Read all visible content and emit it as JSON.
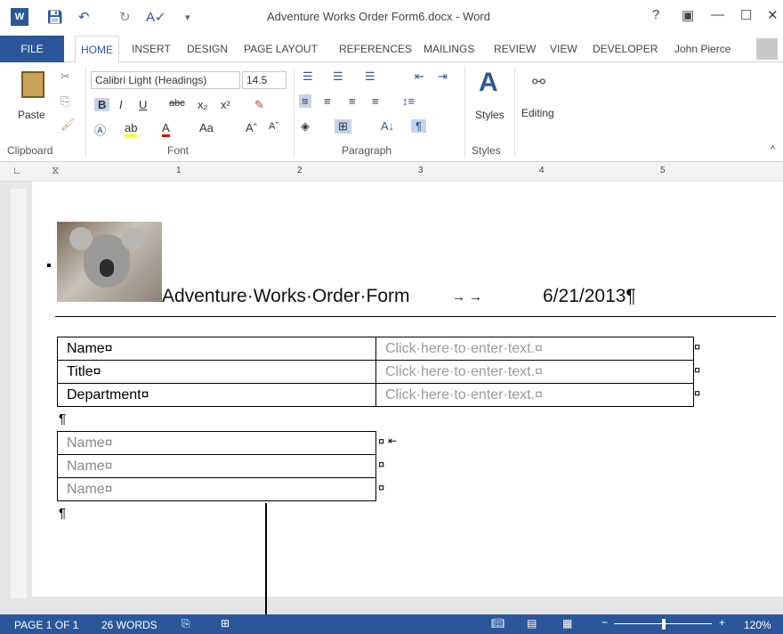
{
  "window": {
    "title": "Adventure Works Order Form6.docx - Word",
    "help_glyph": "?",
    "restore_glyph": "▣",
    "min_glyph": "—",
    "max_glyph": "☐",
    "close_glyph": "✕"
  },
  "tabs": {
    "file": "FILE",
    "items": [
      "HOME",
      "INSERT",
      "DESIGN",
      "PAGE LAYOUT",
      "REFERENCES",
      "MAILINGS",
      "REVIEW",
      "VIEW",
      "DEVELOPER"
    ],
    "user": "John Pierce"
  },
  "ribbon": {
    "paste": "Paste",
    "font_name": "Calibri Light (Headings)",
    "font_size": "14.5",
    "styles": "Styles",
    "editing": "Editing",
    "groups": {
      "clipboard": "Clipboard",
      "font": "Font",
      "paragraph": "Paragraph",
      "styles": "Styles"
    }
  },
  "ruler": {
    "marks": [
      "1",
      "2",
      "3",
      "4",
      "5"
    ]
  },
  "document": {
    "heading": "Adventure·Works·Order·Form",
    "heading_tabs": "→    →",
    "date": "6/21/2013¶",
    "table1": [
      [
        "Name¤",
        "Click·here·to·enter·text.¤"
      ],
      [
        "Title¤",
        "Click·here·to·enter·text.¤"
      ],
      [
        "Department¤",
        "Click·here·to·enter·text.¤"
      ]
    ],
    "row_end": "¤",
    "para_mark": "¶",
    "table2": [
      "Name¤",
      "Name¤",
      "Name¤"
    ]
  },
  "status": {
    "page": "PAGE 1 OF 1",
    "words": "26 WORDS",
    "zoom": "120%"
  },
  "colors": {
    "accent": "#2b579a"
  }
}
